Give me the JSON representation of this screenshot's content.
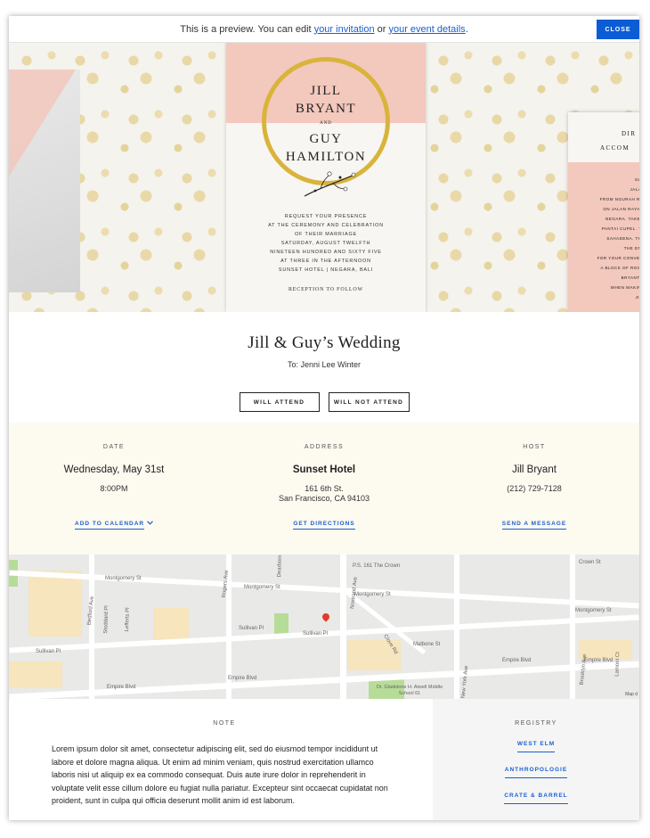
{
  "preview_bar": {
    "text_before": "This is a preview. You can edit ",
    "link_invitation": "your invitation",
    "text_middle": " or ",
    "link_event": "your event details",
    "text_after": ".",
    "close_label": "CLOSE"
  },
  "invitation_card": {
    "name_line_1": "JILL",
    "name_line_2": "BRYANT",
    "and": "AND",
    "name_line_3": "GUY",
    "name_line_4": "HAMILTON",
    "details": [
      "REQUEST YOUR PRESENCE",
      "AT THE CEREMONY AND CELEBRATION",
      "OF THEIR MARRIAGE",
      "SATURDAY, AUGUST TWELFTH",
      "NINETEEN HUNDRED AND SIXTY FIVE",
      "AT THREE IN THE AFTERNOON",
      "SUNSET HOTEL | NEGARA, BALI"
    ],
    "reception": "RECEPTION TO FOLLOW"
  },
  "second_card": {
    "title_1": "DIR",
    "title_2": "ACCOM",
    "lines": [
      "SUN",
      "JALAN",
      "FROM NGURAH RAI",
      "ON JALAN RAYA D",
      "NEGARA. TAKE A",
      "PANTAI CUPEL. TH",
      "SAHADENA. THE",
      "THE END",
      "FOR YOUR CONVENI",
      "A BLOCK OF ROOM",
      "BRYANT-H",
      "WHEN MAKING",
      "JILL"
    ]
  },
  "event": {
    "title": "Jill & Guy’s Wedding",
    "to": "To: Jenni Lee Winter",
    "attend_label": "WILL ATTEND",
    "not_attend_label": "WILL NOT ATTEND"
  },
  "info": {
    "date": {
      "label": "DATE",
      "main": "Wednesday, May 31st",
      "sub": "8:00PM",
      "action": "ADD TO CALENDAR"
    },
    "address": {
      "label": "ADDRESS",
      "main": "Sunset Hotel",
      "sub_1": "161 6th St.",
      "sub_2": "San Francisco, CA 94103",
      "action": "GET DIRECTIONS"
    },
    "host": {
      "label": "HOST",
      "main": "Jill Bryant",
      "sub": "(212) 729-7128",
      "action": "SEND A MESSAGE"
    }
  },
  "map": {
    "labels": [
      "P.S. 161 The Crown",
      "Crown St",
      "Montgomery St",
      "Montgomery St",
      "Montgomery St",
      "Montgomery St",
      "Sullivan Pl",
      "Sullivan Pl",
      "Sullivan Pl",
      "Malbone St",
      "Empire Blvd",
      "Empire Blvd",
      "Empire Blvd",
      "Empire Blvd",
      "Dr. Gladstone H. Atwell Middle School 61",
      "Bedford Ave",
      "Rogers Ave",
      "Nostrand Ave",
      "Brooklyn Ave",
      "New York Ave",
      "Stoddard Pl",
      "Lefferts Pl",
      "Dearborn",
      "Clove Rd",
      "Lamont Ct"
    ],
    "attribution": "Map d"
  },
  "note": {
    "label": "NOTE",
    "text": "Lorem ipsum dolor sit amet, consectetur adipiscing elit, sed do eiusmod tempor incididunt ut labore et dolore magna aliqua. Ut enim ad minim veniam, quis nostrud exercitation ullamco laboris nisi ut aliquip ex ea commodo consequat. Duis aute irure dolor in reprehenderit in voluptate velit esse cillum dolore eu fugiat nulla pariatur. Excepteur sint occaecat cupidatat non proident, sunt in culpa qui officia deserunt mollit anim id est laborum."
  },
  "registry": {
    "label": "REGISTRY",
    "items": [
      "WEST ELM",
      "ANTHROPOLOGIE",
      "CRATE & BARREL"
    ]
  },
  "colors": {
    "accent_blue": "#0b5cd5",
    "link_blue": "#1a5fd0",
    "blush_pink": "#f3c8bd",
    "gold": "#d9b43b",
    "cream_band": "#fdfaf0"
  }
}
